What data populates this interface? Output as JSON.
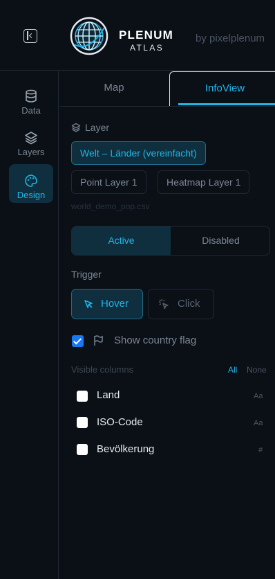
{
  "header": {
    "brand_title": "PLENUM",
    "brand_subtitle": "ATLAS",
    "by_text": "by pixelplenum"
  },
  "sidebar": {
    "items": [
      {
        "label": "Data",
        "icon": "database-icon",
        "active": false
      },
      {
        "label": "Layers",
        "icon": "layers-icon",
        "active": false
      },
      {
        "label": "Design",
        "icon": "palette-icon",
        "active": true
      }
    ]
  },
  "tabs": [
    {
      "label": "Map",
      "active": false
    },
    {
      "label": "InfoView",
      "active": true
    }
  ],
  "layer": {
    "section_label": "Layer",
    "options": [
      {
        "label": "Welt – Länder (vereinfacht)",
        "selected": true
      },
      {
        "label": "Point Layer 1",
        "selected": false
      },
      {
        "label": "Heatmap Layer 1",
        "selected": false
      }
    ],
    "filename": "world_demo_pop.csv"
  },
  "status": {
    "active_label": "Active",
    "disabled_label": "Disabled",
    "selected": "Active"
  },
  "trigger": {
    "section_label": "Trigger",
    "hover_label": "Hover",
    "click_label": "Click",
    "selected": "Hover"
  },
  "flag": {
    "label": "Show country flag",
    "checked": true
  },
  "columns": {
    "section_label": "Visible columns",
    "all_label": "All",
    "none_label": "None",
    "items": [
      {
        "label": "Land",
        "type": "Aa",
        "checked": false
      },
      {
        "label": "ISO-Code",
        "type": "Aa",
        "checked": false
      },
      {
        "label": "Bevölkerung",
        "type": "#",
        "checked": false
      }
    ]
  },
  "colors": {
    "accent": "#22b5e8",
    "background": "#0b0f16",
    "selected_bg": "#0f2e3e",
    "checkbox_checked": "#1877f2"
  }
}
